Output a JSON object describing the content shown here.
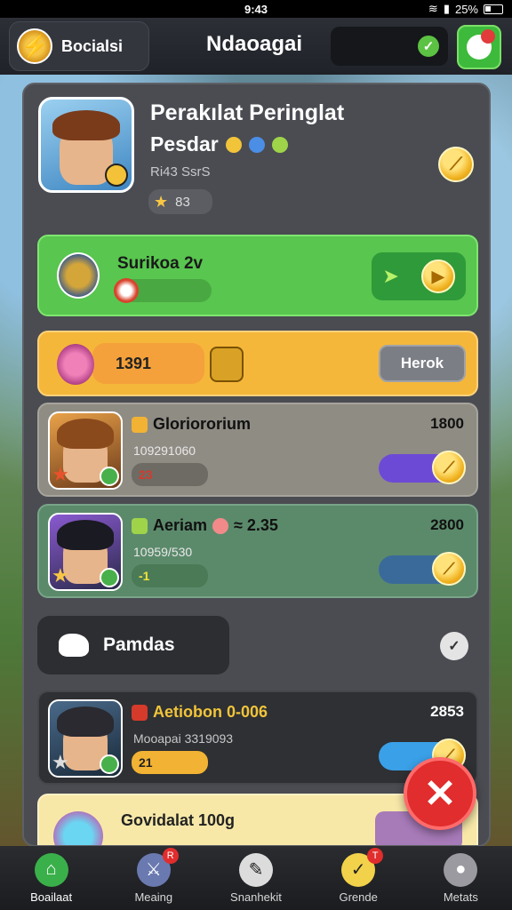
{
  "status_bar": {
    "time": "9:43",
    "battery": "25%"
  },
  "header": {
    "left_label": "Bocialsi",
    "title": "Ndaoagai"
  },
  "profile": {
    "name": "Perakılat Peringlat",
    "subtitle": "Pesdar",
    "meta": "Ri43 SsrS",
    "rating": "83"
  },
  "cards": {
    "green": {
      "title": "Surikoa 2v"
    },
    "orange": {
      "value": "1391",
      "button_label": "Herok"
    },
    "row1": {
      "title": "Gloriororium",
      "meta": "109291060",
      "pill": "23",
      "score": "1800"
    },
    "row2": {
      "title": "Aeriam",
      "title_suffix": "≈ 2.35",
      "meta": "10959/530",
      "pill": "-1",
      "score": "2800"
    },
    "section": {
      "label": "Pamdas"
    },
    "row3": {
      "title": "Aetiobon 0-006",
      "meta": "Mooapai 3319093",
      "pill": "21",
      "score": "2853"
    },
    "yellow": {
      "title": "Govidalat 100g"
    }
  },
  "bottom_nav": [
    {
      "label": "Boailaat",
      "icon": "house-icon",
      "active": true,
      "badge": ""
    },
    {
      "label": "Meaing",
      "icon": "sword-icon",
      "active": false,
      "badge": "R"
    },
    {
      "label": "Snanhekit",
      "icon": "tools-icon",
      "active": false,
      "badge": ""
    },
    {
      "label": "Grende",
      "icon": "trophy-icon",
      "active": false,
      "badge": "T"
    },
    {
      "label": "Metats",
      "icon": "person-icon",
      "active": false,
      "badge": ""
    }
  ],
  "colors": {
    "green": "#58c64f",
    "orange": "#f5b73a",
    "close": "#e12d2d",
    "panel": "#4a4c52"
  }
}
